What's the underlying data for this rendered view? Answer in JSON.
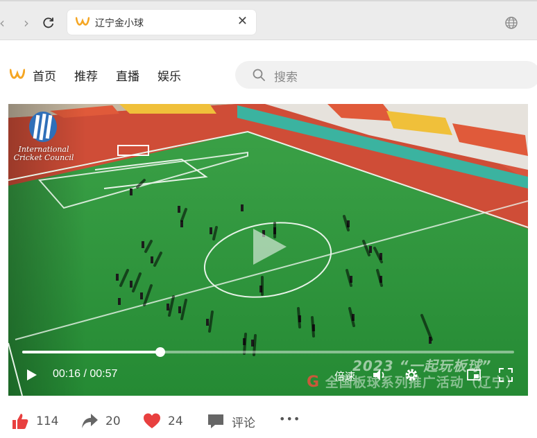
{
  "browser": {
    "tab_title": "辽宁金小球",
    "close_glyph": "✕",
    "back_glyph": "‹",
    "forward_glyph": "›",
    "reload_glyph": "⟳"
  },
  "site_nav": {
    "items": [
      "首页",
      "推荐",
      "直播",
      "娱乐"
    ],
    "search_placeholder": "搜索"
  },
  "video": {
    "logo_text_line1": "International",
    "logo_text_line2": "Cricket Council",
    "current_time": "00:16",
    "duration": "00:57",
    "time_display": "00:16 / 00:57",
    "progress": 0.2807,
    "overlay_title": "2023 “一起玩板球”",
    "overlay_subtitle": "全国板球系列推广活动（辽宁）",
    "speed_label": "倍速",
    "icons": [
      "play-icon",
      "volume-icon",
      "settings-icon",
      "pip-icon",
      "fullscreen-icon"
    ]
  },
  "actions": {
    "like_count": "114",
    "share_count": "20",
    "favorite_count": "24",
    "comment_label": "评论",
    "more_glyph": "•••"
  },
  "colors": {
    "brand_orange": "#f5a623",
    "like_red": "#e8403f",
    "field_green": "#2f8f3a",
    "track_red": "#d9553e"
  }
}
